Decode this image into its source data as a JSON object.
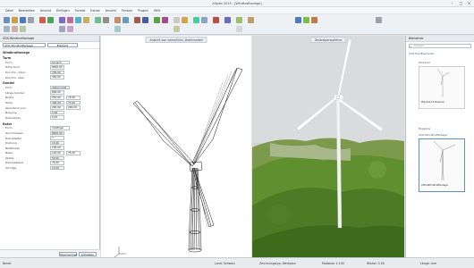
{
  "titlebar": {
    "title": "Allplan 2019 - [Windkraftanlage]"
  },
  "menu": [
    "Datei",
    "Bearbeiten",
    "Ansicht",
    "Einfügen",
    "Format",
    "Extras",
    "Ansicht",
    "Fenster",
    "Plugins",
    "Hilfe"
  ],
  "left_panel": {
    "header": "CDS-Windkraftanlage",
    "selector_value": "CDS Windkraftanlage",
    "tab_label": "Element",
    "title": "Windkraftanlage",
    "sections": [
      {
        "name": "Turm",
        "rows": [
          {
            "label": "Form",
            "value": "konisch"
          },
          {
            "label": "Höhe Turm",
            "value": "8000.00"
          },
          {
            "label": "Durchm. unten",
            "value": "700.00"
          },
          {
            "label": "Durchm. oben",
            "value": "350.00"
          }
        ]
      },
      {
        "name": "Gondel",
        "rows": [
          {
            "label": "Form",
            "value": "abgerundet"
          },
          {
            "label": "Länge Gondel",
            "value": "800.00"
          },
          {
            "label": "Breite",
            "value": "250.00",
            "value2": "75.00"
          },
          {
            "label": "Höhe",
            "value": "300.00",
            "value2": "75.00"
          },
          {
            "label": "Überstand vorn",
            "value": "200.00",
            "value2": "200.00"
          },
          {
            "label": "Neigung",
            "value": "5.00"
          },
          {
            "label": "Drehwinkel",
            "value": "0.00"
          }
        ]
      },
      {
        "name": "Rotor",
        "rows": [
          {
            "label": "Form",
            "value": "dreiflügel"
          },
          {
            "label": "Durchmesser",
            "value": "8000.00"
          },
          {
            "label": "Rotorblätter",
            "value": "3"
          },
          {
            "label": "Drehung",
            "value": "15.00"
          },
          {
            "label": "Blattbreite",
            "value": "100.00"
          },
          {
            "label": "Nabe",
            "value": "120.00",
            "value2": "75.00"
          },
          {
            "label": "Spitze",
            "value": "50.00"
          },
          {
            "label": "Rotorabstand",
            "value": "75.00"
          },
          {
            "label": "Schräge",
            "value": "10.00"
          }
        ]
      }
    ],
    "footer": {
      "apply": "Übernehmen",
      "close": "Schließen"
    }
  },
  "viewport_wire": {
    "tab": "Ansicht von vorne/links, Drahtmodell"
  },
  "viewport_render": {
    "tab": "Zentralperspektive"
  },
  "right_panel": {
    "header": "Bibliothek",
    "search_placeholder": "Suchen",
    "breadcrumb": "CDS-PlanElemente",
    "card1_title": "Windrad",
    "card1_sub": "Windrad 3 Rotoren",
    "group_label": "Ergebnis",
    "card2_title": "CDS-Windkraftanlage",
    "card2_label": "CDS-Windkraftanlage"
  },
  "statusbar": {
    "left": "Bereit",
    "mid1": "Land: Schweiz",
    "mid2": "Zeichnungstyp: Werkplan",
    "mid3": "Maßstab: 1:100",
    "right": "Winkel: 0.00",
    "right2": "Länge: mm"
  },
  "colors": {
    "sky": "#dcdfe1",
    "grass": "#5f8f2e",
    "tower": "#f2f2f2"
  }
}
